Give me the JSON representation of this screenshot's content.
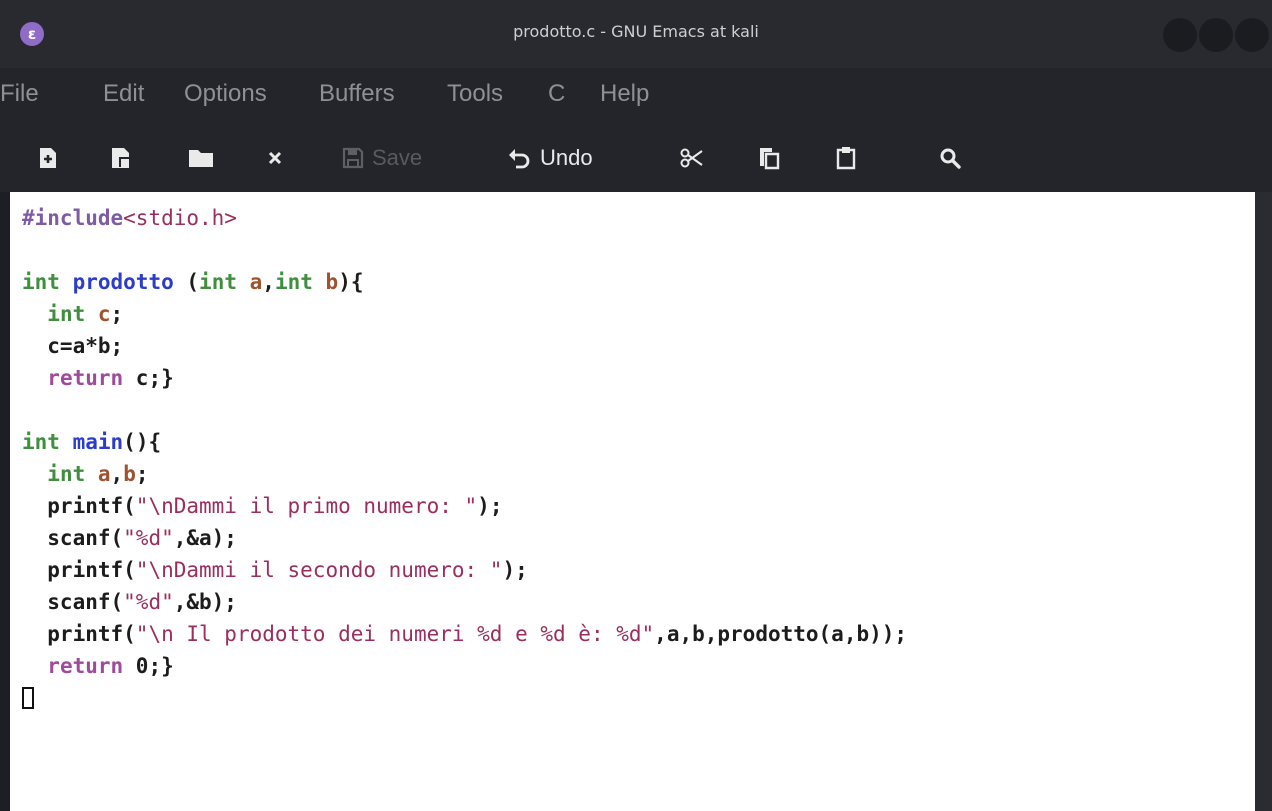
{
  "window": {
    "title": "prodotto.c - GNU Emacs at kali",
    "icon_letter": "ε"
  },
  "menu": [
    "File",
    "Edit",
    "Options",
    "Buffers",
    "Tools",
    "C",
    "Help"
  ],
  "toolbar": {
    "save_label": "Save",
    "undo_label": "Undo",
    "icons": [
      "new-file-icon",
      "open-file-icon",
      "open-directory-icon",
      "close-icon",
      "save-icon",
      "undo-icon",
      "cut-icon",
      "copy-icon",
      "paste-icon",
      "search-icon"
    ]
  },
  "editor": {
    "language": "C",
    "lines": [
      [
        [
          "pp",
          "#include"
        ],
        [
          "st",
          "<stdio.h>"
        ]
      ],
      [],
      [
        [
          "ty",
          "int"
        ],
        [
          "",
          " "
        ],
        [
          "fn",
          "prodotto"
        ],
        [
          "",
          " ("
        ],
        [
          "ty",
          "int"
        ],
        [
          "",
          " "
        ],
        [
          "vn",
          "a"
        ],
        [
          "",
          ","
        ],
        [
          "ty",
          "int"
        ],
        [
          "",
          " "
        ],
        [
          "vn",
          "b"
        ],
        [
          "",
          "){"
        ]
      ],
      [
        [
          "",
          "  "
        ],
        [
          "ty",
          "int"
        ],
        [
          "",
          " "
        ],
        [
          "vn",
          "c"
        ],
        [
          "",
          ";"
        ]
      ],
      [
        [
          "",
          "  c=a*b;"
        ]
      ],
      [
        [
          "",
          "  "
        ],
        [
          "kw",
          "return"
        ],
        [
          "",
          " c;}"
        ]
      ],
      [],
      [
        [
          "ty",
          "int"
        ],
        [
          "",
          " "
        ],
        [
          "fn",
          "main"
        ],
        [
          "",
          "(){"
        ]
      ],
      [
        [
          "",
          "  "
        ],
        [
          "ty",
          "int"
        ],
        [
          "",
          " "
        ],
        [
          "vn",
          "a"
        ],
        [
          "",
          ","
        ],
        [
          "vn",
          "b"
        ],
        [
          "",
          ";"
        ]
      ],
      [
        [
          "",
          "  printf("
        ],
        [
          "st",
          "\"\\nDammi il primo numero: \""
        ],
        [
          "",
          ");"
        ]
      ],
      [
        [
          "",
          "  scanf("
        ],
        [
          "st",
          "\"%d\""
        ],
        [
          "",
          ",&a);"
        ]
      ],
      [
        [
          "",
          "  printf("
        ],
        [
          "st",
          "\"\\nDammi il secondo numero: \""
        ],
        [
          "",
          ");"
        ]
      ],
      [
        [
          "",
          "  scanf("
        ],
        [
          "st",
          "\"%d\""
        ],
        [
          "",
          ",&b);"
        ]
      ],
      [
        [
          "",
          "  printf("
        ],
        [
          "st",
          "\"\\n Il prodotto dei numeri %d e %d è: %d\""
        ],
        [
          "",
          ",a,b,prodotto(a,b));"
        ]
      ],
      [
        [
          "",
          "  "
        ],
        [
          "kw",
          "return"
        ],
        [
          "",
          " 0;}"
        ]
      ]
    ]
  },
  "colors": {
    "background": "#1e1f24",
    "editor_bg": "#ffffff",
    "preprocessor": "#7d5ba6",
    "type": "#3f8f3f",
    "function": "#2c3ec9",
    "variable": "#a0522d",
    "keyword": "#a04a9c",
    "string": "#9b2e5e"
  }
}
